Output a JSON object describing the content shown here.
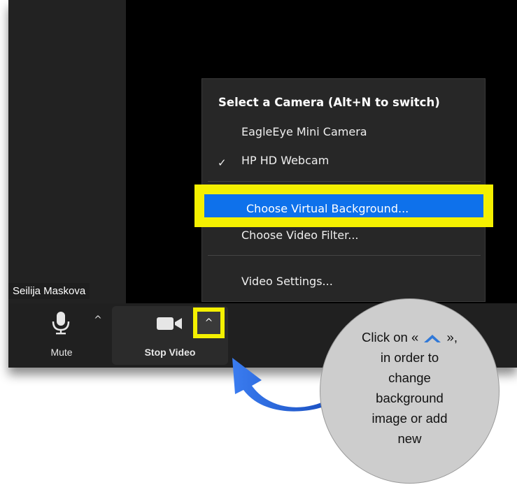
{
  "participant": {
    "name": "Seilija Maskova"
  },
  "toolbar": {
    "mute_label": "Mute",
    "mute_caret": "^",
    "stop_video_label": "Stop Video",
    "video_caret": "^"
  },
  "camera_menu": {
    "header": "Select a Camera (Alt+N to switch)",
    "cameras": [
      {
        "label": "EagleEye Mini Camera",
        "checked": false
      },
      {
        "label": "HP HD Webcam",
        "checked": true
      }
    ],
    "check_mark": "✓",
    "choose_virtual_background": "Choose Virtual Background...",
    "choose_video_filter": "Choose Video Filter...",
    "video_settings": "Video Settings..."
  },
  "callout": {
    "line1_before": "Click on  «",
    "line1_after": "»,",
    "line2": "in order to",
    "line3": "change",
    "line4": "background",
    "line5": "image or add",
    "line6": "new"
  },
  "colors": {
    "highlight_yellow": "#f4f000",
    "selection_blue": "#0e71eb",
    "arrow_blue": "#1f5fd6"
  },
  "icons": {
    "mic": "microphone-icon",
    "camera": "video-camera-icon",
    "chevron": "chevron-up-icon",
    "arrow": "curved-arrow-icon"
  }
}
